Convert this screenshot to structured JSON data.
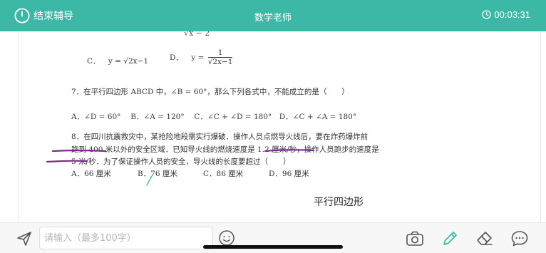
{
  "header": {
    "end_label": "结束辅导",
    "title": "数学老师",
    "timer": "00:03:31"
  },
  "document": {
    "top_cutoff": "√x − 2",
    "q6_options": {
      "c_label": "C．",
      "c_expr": "y = √2x−1",
      "d_label": "D．",
      "d_expr_prefix": "y =",
      "d_num": "1",
      "d_den": "√2x−1"
    },
    "q7": {
      "stem": "7．在平行四边形 ABCD 中，∠B = 60°，那么下列各式中，不能成立的是（　　）",
      "options": "A．∠D = 60°　 B．∠A = 120°　 C．∠C + ∠D = 180°　D．∠C + ∠A = 180°"
    },
    "q8": {
      "line1": "8．在四川抗震救灾中，某抢险地段需实行爆破．操作人员点燃导火线后，要在炸药爆炸前",
      "line2": "跑到 400 米以外的安全区域．已知导火线的燃烧速度是 1.2 厘米/秒，操作人员跑步的速度是",
      "line3": "5 米/秒．为了保证操作人员的安全，导火线的长度要超过（　　）",
      "options": [
        "A．66 厘米",
        "B．76 厘米",
        "C．86 厘米",
        "D．96 厘米"
      ]
    },
    "note": "平行四边形"
  },
  "toolbar": {
    "input_placeholder": "请输入（最多100字）",
    "input_value": ""
  },
  "icons": {
    "end": "power-icon",
    "timer": "clock-icon",
    "send": "send-icon",
    "emoji": "emoji-icon",
    "camera": "camera-icon",
    "pen": "pen-icon",
    "eraser": "eraser-icon",
    "chat": "chat-icon"
  },
  "colors": {
    "brand": "#3cb9a6",
    "ink": "#7b2a8f",
    "pen_active": "#3cb9a6"
  }
}
